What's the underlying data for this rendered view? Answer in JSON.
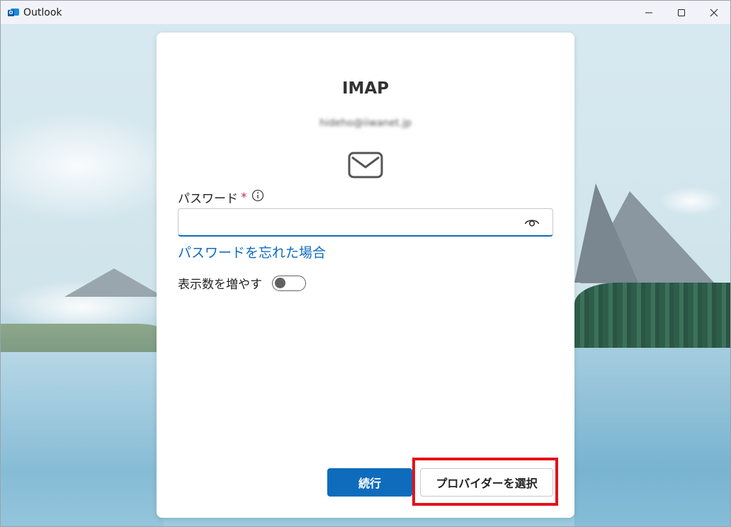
{
  "window": {
    "title": "Outlook",
    "app_icon_letter": "O",
    "controls": {
      "minimize": "minimize-icon",
      "maximize": "maximize-icon",
      "close": "close-icon"
    }
  },
  "dialog": {
    "title": "IMAP",
    "email": "hideho@iiwanet.jp",
    "password_label": "パスワード",
    "required_mark": "*",
    "password_value": "",
    "forgot_link": "パスワードを忘れた場合",
    "show_more_label": "表示数を増やす",
    "show_more_on": false,
    "continue_button": "続行",
    "choose_provider_button": "プロバイダーを選択"
  },
  "colors": {
    "accent": "#0f6cbd",
    "required": "#c4314b",
    "highlight_box": "#e3121b"
  }
}
